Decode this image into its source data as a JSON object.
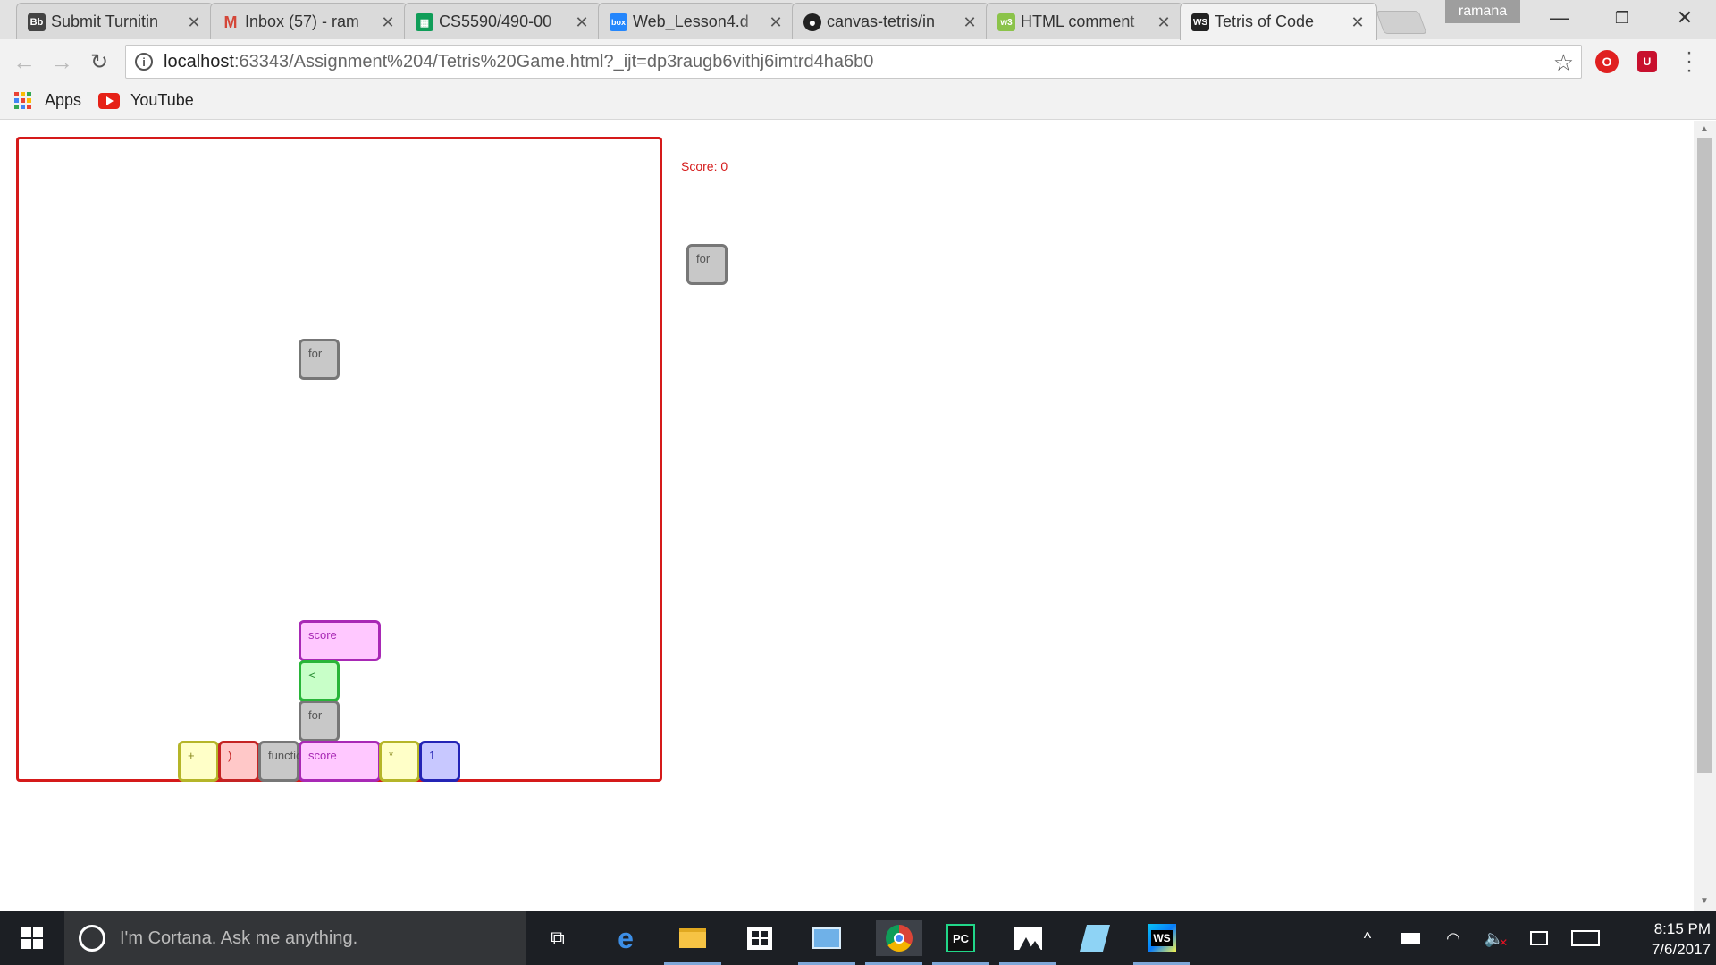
{
  "tabs": [
    {
      "title": "Submit Turnitin",
      "icon": "blackboard-icon",
      "color": "#444444",
      "badge": "Bb"
    },
    {
      "title": "Inbox (57) - ram",
      "icon": "gmail-icon",
      "color": "#d44638",
      "badge": "M"
    },
    {
      "title": "CS5590/490-00",
      "icon": "sheets-icon",
      "color": "#0f9d58",
      "badge": "▦"
    },
    {
      "title": "Web_Lesson4.d",
      "icon": "box-icon",
      "color": "#2486fc",
      "badge": "box"
    },
    {
      "title": "canvas-tetris/in",
      "icon": "github-icon",
      "color": "#222222",
      "badge": "●"
    },
    {
      "title": "HTML comment",
      "icon": "w3schools-icon",
      "color": "#8bc34a",
      "badge": "w3"
    },
    {
      "title": "Tetris of Code",
      "icon": "webstorm-icon",
      "color": "#222222",
      "badge": "WS",
      "active": true
    }
  ],
  "profile_name": "ramana",
  "address": {
    "host": "localhost",
    "path": ":63343/Assignment%204/Tetris%20Game.html?_ijt=dp3raugb6vithj6imtrd4ha6b0"
  },
  "bookmarks": {
    "apps": "Apps",
    "youtube": "YouTube"
  },
  "game": {
    "score_text": "Score: 0",
    "next_block": {
      "label": "for",
      "color": "gray"
    },
    "falling_block": {
      "label": "for",
      "color": "gray"
    },
    "stack": [
      {
        "label": "score",
        "color": "pink",
        "wide": true
      },
      {
        "label": "<",
        "color": "green"
      },
      {
        "label": "for",
        "color": "gray"
      },
      {
        "label": "+",
        "color": "yellow"
      },
      {
        "label": ")",
        "color": "red"
      },
      {
        "label": "function",
        "color": "gray"
      },
      {
        "label": "score",
        "color": "pink",
        "wide": true
      },
      {
        "label": "*",
        "color": "yellow"
      },
      {
        "label": "1",
        "color": "blue"
      }
    ]
  },
  "colors": {
    "board_border": "#d51a1a",
    "score": "#d51a1a"
  },
  "taskbar": {
    "cortana_text": "I'm Cortana. Ask me anything.",
    "apps": [
      "task-view-icon",
      "edge-icon",
      "file-explorer-icon",
      "store-icon",
      "control-panel-icon",
      "chrome-icon",
      "pycharm-icon",
      "photos-icon",
      "notepad-icon",
      "webstorm-icon"
    ],
    "time": "8:15 PM",
    "date": "7/6/2017"
  }
}
